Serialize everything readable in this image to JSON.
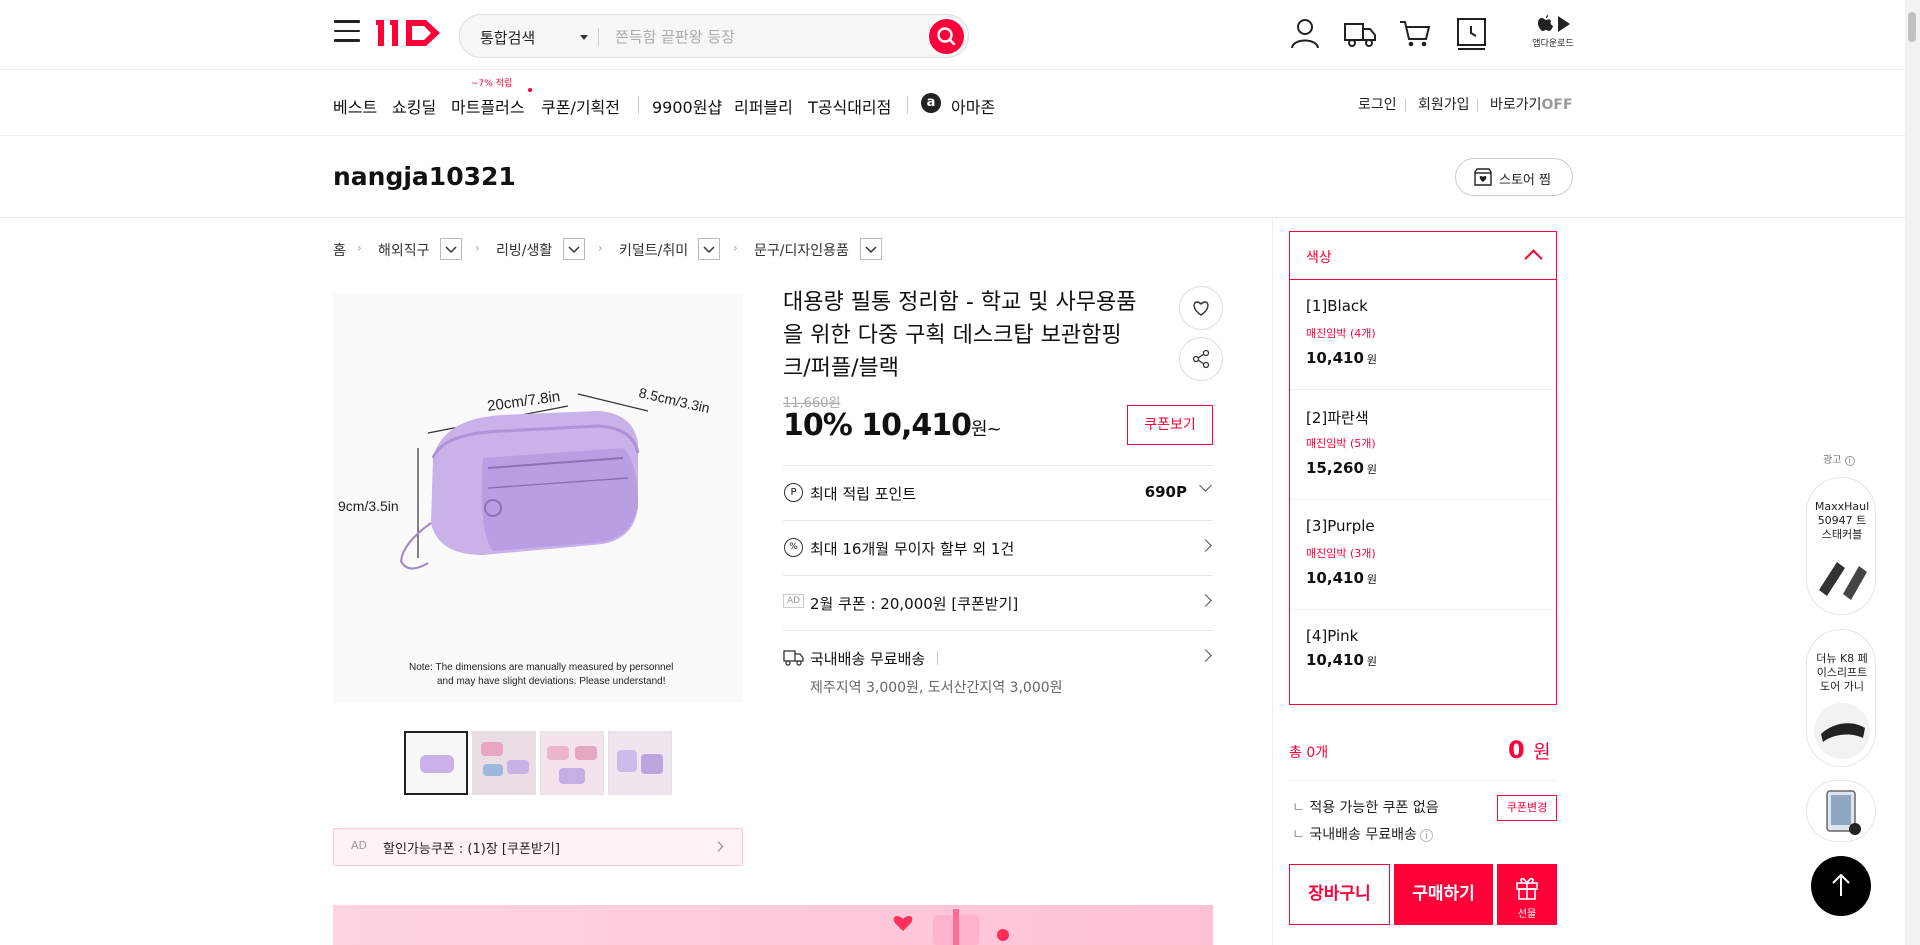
{
  "header": {
    "logo": "11",
    "search_category": "통합검색",
    "search_placeholder": "쫀득함 끝판왕 등장",
    "app_download": "앱다운로드"
  },
  "nav": {
    "items": [
      "베스트",
      "쇼킹딜",
      "마트플러스",
      "쿠폰/기획전",
      "9900원샵",
      "리퍼블리",
      "T공식대리점",
      "아마존"
    ],
    "mart_badge": "~7% 적립",
    "amazon_logo": "a",
    "login": "로그인",
    "signup": "회원가입",
    "shortcut": "바로가기",
    "shortcut_state": "OFF"
  },
  "store": {
    "name": "nangja10321",
    "fav_button": "스토어 찜"
  },
  "breadcrumb": [
    "홈",
    "해외직구",
    "리빙/생활",
    "키덜트/취미",
    "문구/디자인용품"
  ],
  "product": {
    "title": "대용량 필통 정리함 - 학교 및 사무용품을 위한 다중 구획 데스크탑 보관함핑크/퍼플/블랙",
    "title_line1": "대용량 필통 정리함 - 학교 및 사무용품",
    "title_line2": "을 위한 다중 구획 데스크탑 보관함핑",
    "title_line3": "크/퍼플/블랙",
    "image_dim_width": "20cm/7.8in",
    "image_dim_depth": "8.5cm/3.3in",
    "image_dim_height": "9cm/3.5in",
    "image_note_1": "Note: The dimensions are manually measured by personnel",
    "image_note_2": "and may have slight deviations. Please understand!",
    "original_price": "11,660원",
    "discount": "10%",
    "sale_price": "10,410",
    "sale_unit": "원~",
    "coupon_view": "쿠폰보기",
    "points_label": "최대 적립 포인트",
    "points_value": "690P",
    "installment": "최대 16개월 무이자 할부 외 1건",
    "ad_label": "AD",
    "coupon_feb": "2월 쿠폰 : 20,000원 [쿠폰받기]",
    "shipping": "국내배송 무료배송",
    "shipping_extra": "제주지역 3,000원, 도서산간지역 3,000원",
    "discount_coupon": "할인가능쿠폰 : (1)장 [쿠폰받기]"
  },
  "options": {
    "header": "색상",
    "items": [
      {
        "name": "[1]Black",
        "stock": "매진임박 (4개)",
        "price": "10,410",
        "unit": "원"
      },
      {
        "name": "[2]파란색",
        "stock": "매진임박 (5개)",
        "price": "15,260",
        "unit": "원"
      },
      {
        "name": "[3]Purple",
        "stock": "매진임박 (3개)",
        "price": "10,410",
        "unit": "원"
      },
      {
        "name": "[4]Pink",
        "stock": "",
        "price": "10,410",
        "unit": "원"
      }
    ]
  },
  "order": {
    "total_label": "총 0개",
    "total_value": "0",
    "total_unit": "원",
    "no_coupon": "적용 가능한 쿠폰 없음",
    "coupon_change": "쿠폰변경",
    "shipping": "국내배송 무료배송",
    "cart": "장바구니",
    "buy": "구매하기",
    "gift": "선물"
  },
  "side_ads": {
    "label": "광고",
    "items": [
      "MaxxHaul 50947 트 스태커블",
      "더뉴 K8 페 이스리프트 도어 가니"
    ]
  },
  "colors": {
    "accent": "#ff0038"
  }
}
